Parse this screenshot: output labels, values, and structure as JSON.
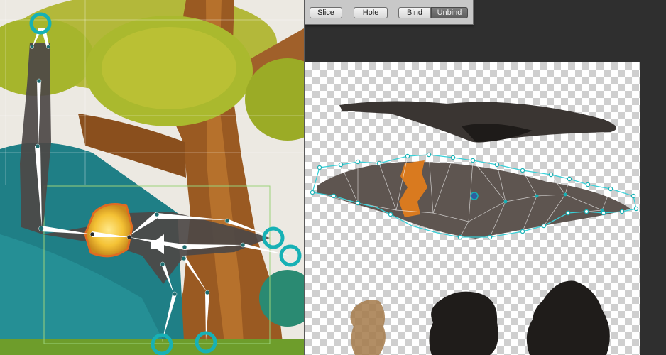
{
  "toolbar": {
    "slice_label": "Slice",
    "hole_label": "Hole",
    "bind_label": "Bind",
    "unbind_label": "Unbind"
  },
  "colors": {
    "bone": "#ffffff",
    "joint_handle": "#17b1b5",
    "selection_outline": "#e06b22",
    "mesh_outline": "#3ad0d8",
    "sky": "#ece9e2",
    "foliage": "#a6b52c",
    "trunk": "#9a5a22",
    "water": "#1f7f86",
    "checker_light": "#ffffff",
    "checker_dark": "#cfcfcf"
  },
  "icons": [
    "joint-handle-icon",
    "speaker-gizmo-icon",
    "mesh-pivot-icon"
  ]
}
